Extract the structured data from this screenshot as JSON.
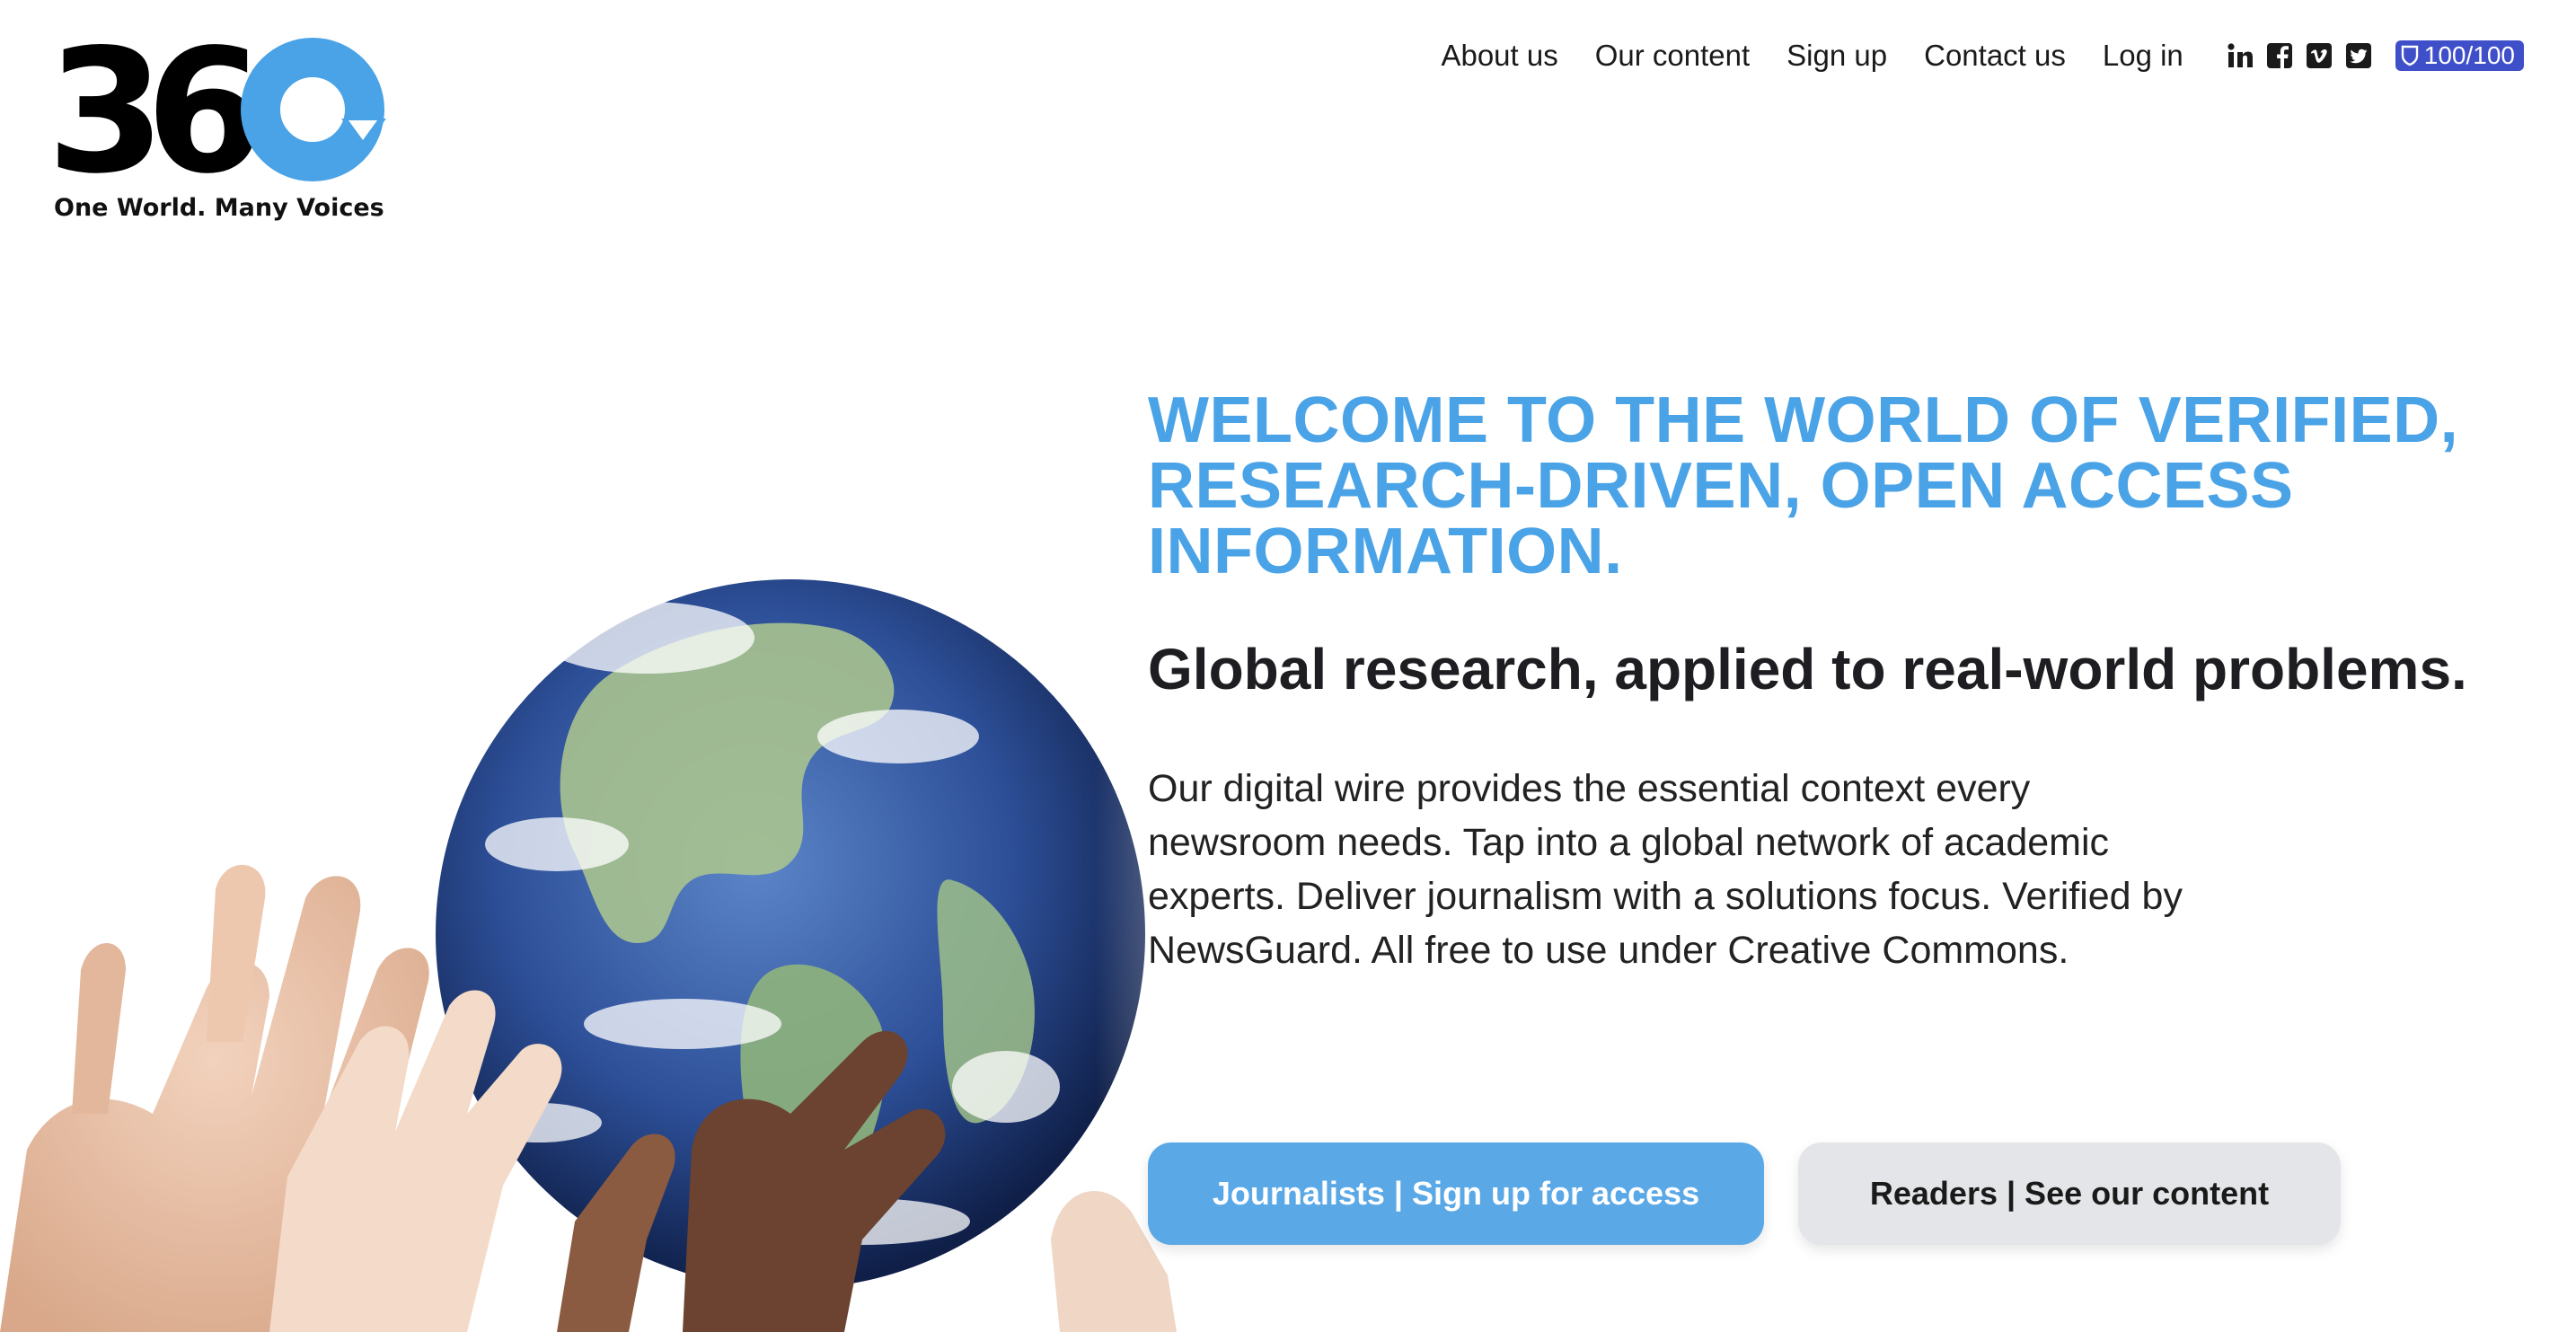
{
  "logo": {
    "wordmark": "360",
    "tagline": "One World. Many Voices",
    "accent_color": "#4aa3e6"
  },
  "nav": {
    "links": [
      "About us",
      "Our content",
      "Sign up",
      "Contact us",
      "Log in"
    ],
    "social_icons": [
      "linkedin-icon",
      "facebook-icon",
      "vimeo-icon",
      "twitter-icon"
    ],
    "newsguard_score": "100/100"
  },
  "hero": {
    "headline": "WELCOME TO THE WORLD OF VERIFIED, RESEARCH-DRIVEN, OPEN ACCESS INFORMATION.",
    "subhead": "Global research, applied to real-world problems.",
    "body": "Our digital wire provides the essential context every newsroom needs. Tap into a global network of academic experts. Deliver journalism with a solutions focus. Verified by NewsGuard. All free to use under Creative Commons.",
    "primary_cta": "Journalists | Sign up for access",
    "secondary_cta": "Readers | See our content",
    "image_subject": "hands-holding-globe"
  },
  "colors": {
    "headline_blue": "#4aa3e6",
    "button_blue": "#5aa8e6",
    "button_gray": "#e3e5e8",
    "newsguard_blue": "#3f4fc9"
  }
}
